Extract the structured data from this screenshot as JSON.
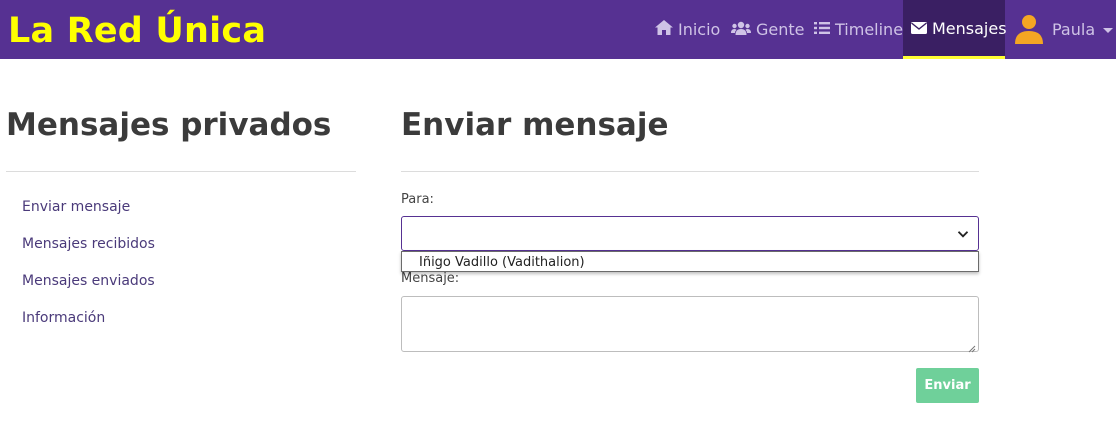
{
  "brand": "La Red Única",
  "nav": {
    "inicio": "Inicio",
    "gente": "Gente",
    "timeline": "Timeline",
    "mensajes": "Mensajes",
    "user": "Paula"
  },
  "sidebar": {
    "title": "Mensajes privados",
    "items": [
      {
        "label": "Enviar mensaje"
      },
      {
        "label": "Mensajes recibidos"
      },
      {
        "label": "Mensajes enviados"
      },
      {
        "label": "Información"
      }
    ]
  },
  "form": {
    "title": "Enviar mensaje",
    "to_label": "Para:",
    "to_value": "",
    "to_options": [
      "Iñigo Vadillo (Vadithalion)"
    ],
    "message_label": "Mensaje:",
    "message_value": "",
    "submit_label": "Enviar"
  },
  "colors": {
    "navbar": "#563192",
    "brand": "#ffff00",
    "active_tab": "#3a1f63",
    "active_underline": "#ffff33",
    "submit": "#6fd09a"
  },
  "icons": {
    "inicio": "home-icon",
    "gente": "users-icon",
    "timeline": "list-icon",
    "mensajes": "envelope-icon",
    "user": "user-avatar-icon"
  }
}
